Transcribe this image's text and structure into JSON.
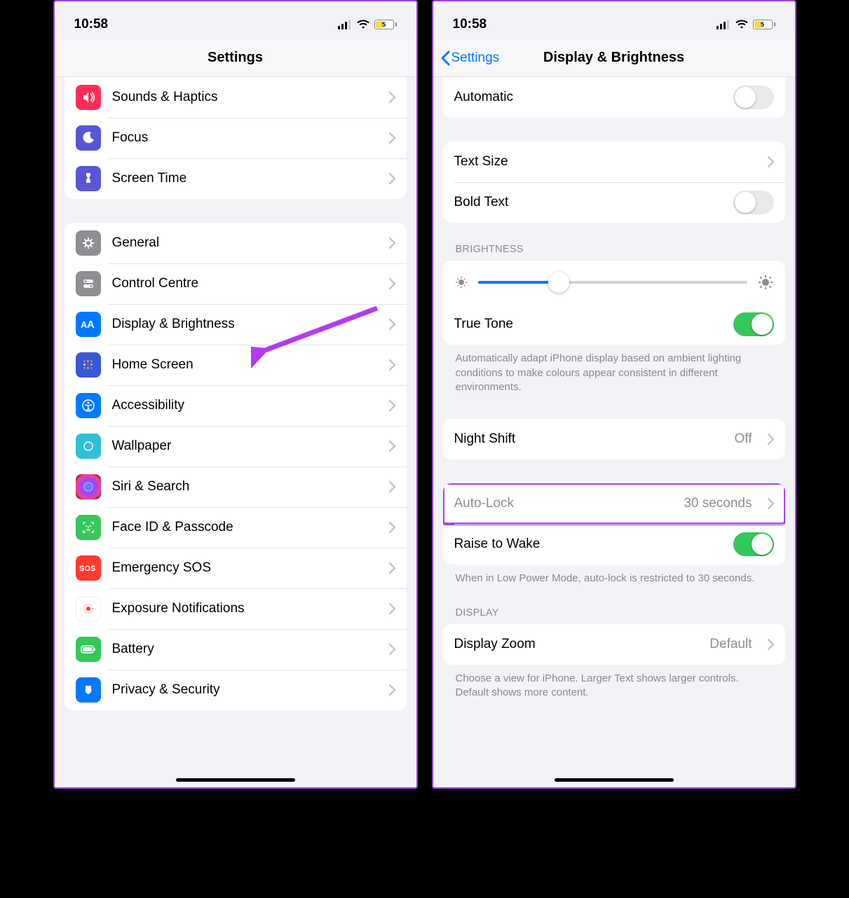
{
  "status": {
    "time": "10:58",
    "battery_pct": "5"
  },
  "left": {
    "title": "Settings",
    "group1": [
      {
        "label": "Sounds & Haptics"
      },
      {
        "label": "Focus"
      },
      {
        "label": "Screen Time"
      }
    ],
    "group2": [
      {
        "label": "General"
      },
      {
        "label": "Control Centre"
      },
      {
        "label": "Display & Brightness"
      },
      {
        "label": "Home Screen"
      },
      {
        "label": "Accessibility"
      },
      {
        "label": "Wallpaper"
      },
      {
        "label": "Siri & Search"
      },
      {
        "label": "Face ID & Passcode"
      },
      {
        "label": "Emergency SOS"
      },
      {
        "label": "Exposure Notifications"
      },
      {
        "label": "Battery"
      },
      {
        "label": "Privacy & Security"
      }
    ]
  },
  "right": {
    "back": "Settings",
    "title": "Display & Brightness",
    "automatic": "Automatic",
    "text_size": "Text Size",
    "bold_text": "Bold Text",
    "brightness_header": "BRIGHTNESS",
    "brightness_pct": 30,
    "true_tone": "True Tone",
    "true_tone_footer": "Automatically adapt iPhone display based on ambient lighting conditions to make colours appear consistent in different environments.",
    "night_shift": "Night Shift",
    "night_shift_val": "Off",
    "auto_lock": "Auto-Lock",
    "auto_lock_val": "30 seconds",
    "raise_to_wake": "Raise to Wake",
    "raise_footer": "When in Low Power Mode, auto-lock is restricted to 30 seconds.",
    "display_header": "DISPLAY",
    "display_zoom": "Display Zoom",
    "display_zoom_val": "Default",
    "display_zoom_footer": "Choose a view for iPhone. Larger Text shows larger controls. Default shows more content."
  }
}
